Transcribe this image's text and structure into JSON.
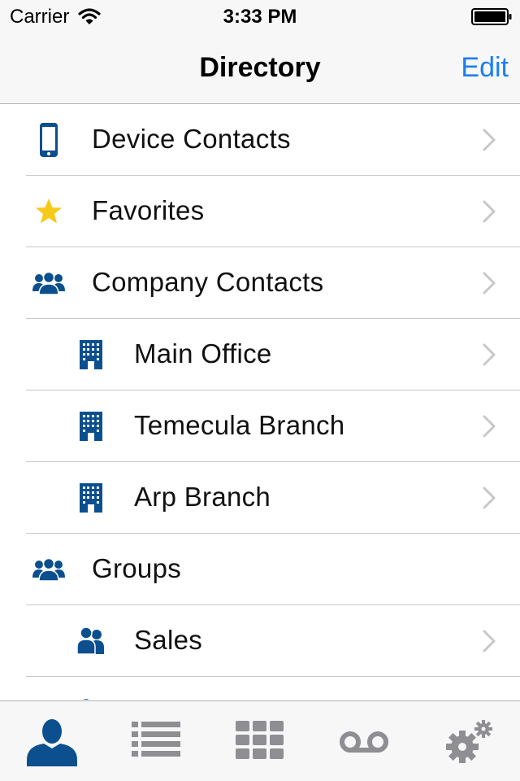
{
  "status_bar": {
    "carrier": "Carrier",
    "time": "3:33 PM"
  },
  "nav": {
    "title": "Directory",
    "edit_label": "Edit"
  },
  "colors": {
    "accent": "#1a7ef4",
    "icon_blue": "#0b4f8f",
    "star": "#f7c919",
    "tab_inactive": "#8e8e93",
    "tab_active": "#0b4f8f"
  },
  "list": {
    "items": [
      {
        "label": "Device Contacts",
        "icon": "phone-icon",
        "chevron": true
      },
      {
        "label": "Favorites",
        "icon": "star-icon",
        "chevron": true
      },
      {
        "label": "Company Contacts",
        "icon": "people-icon",
        "chevron": true
      },
      {
        "label": "Main Office",
        "icon": "building-icon",
        "chevron": true
      },
      {
        "label": "Temecula Branch",
        "icon": "building-icon",
        "chevron": true
      },
      {
        "label": "Arp Branch",
        "icon": "building-icon",
        "chevron": true
      },
      {
        "label": "Groups",
        "icon": "people-icon",
        "chevron": false
      },
      {
        "label": "Sales",
        "icon": "group-icon",
        "chevron": true
      }
    ]
  },
  "tabbar": {
    "tabs": [
      {
        "icon": "contacts-icon",
        "active": true
      },
      {
        "icon": "list-icon",
        "active": false
      },
      {
        "icon": "keypad-icon",
        "active": false
      },
      {
        "icon": "voicemail-icon",
        "active": false
      },
      {
        "icon": "settings-icon",
        "active": false
      }
    ]
  }
}
